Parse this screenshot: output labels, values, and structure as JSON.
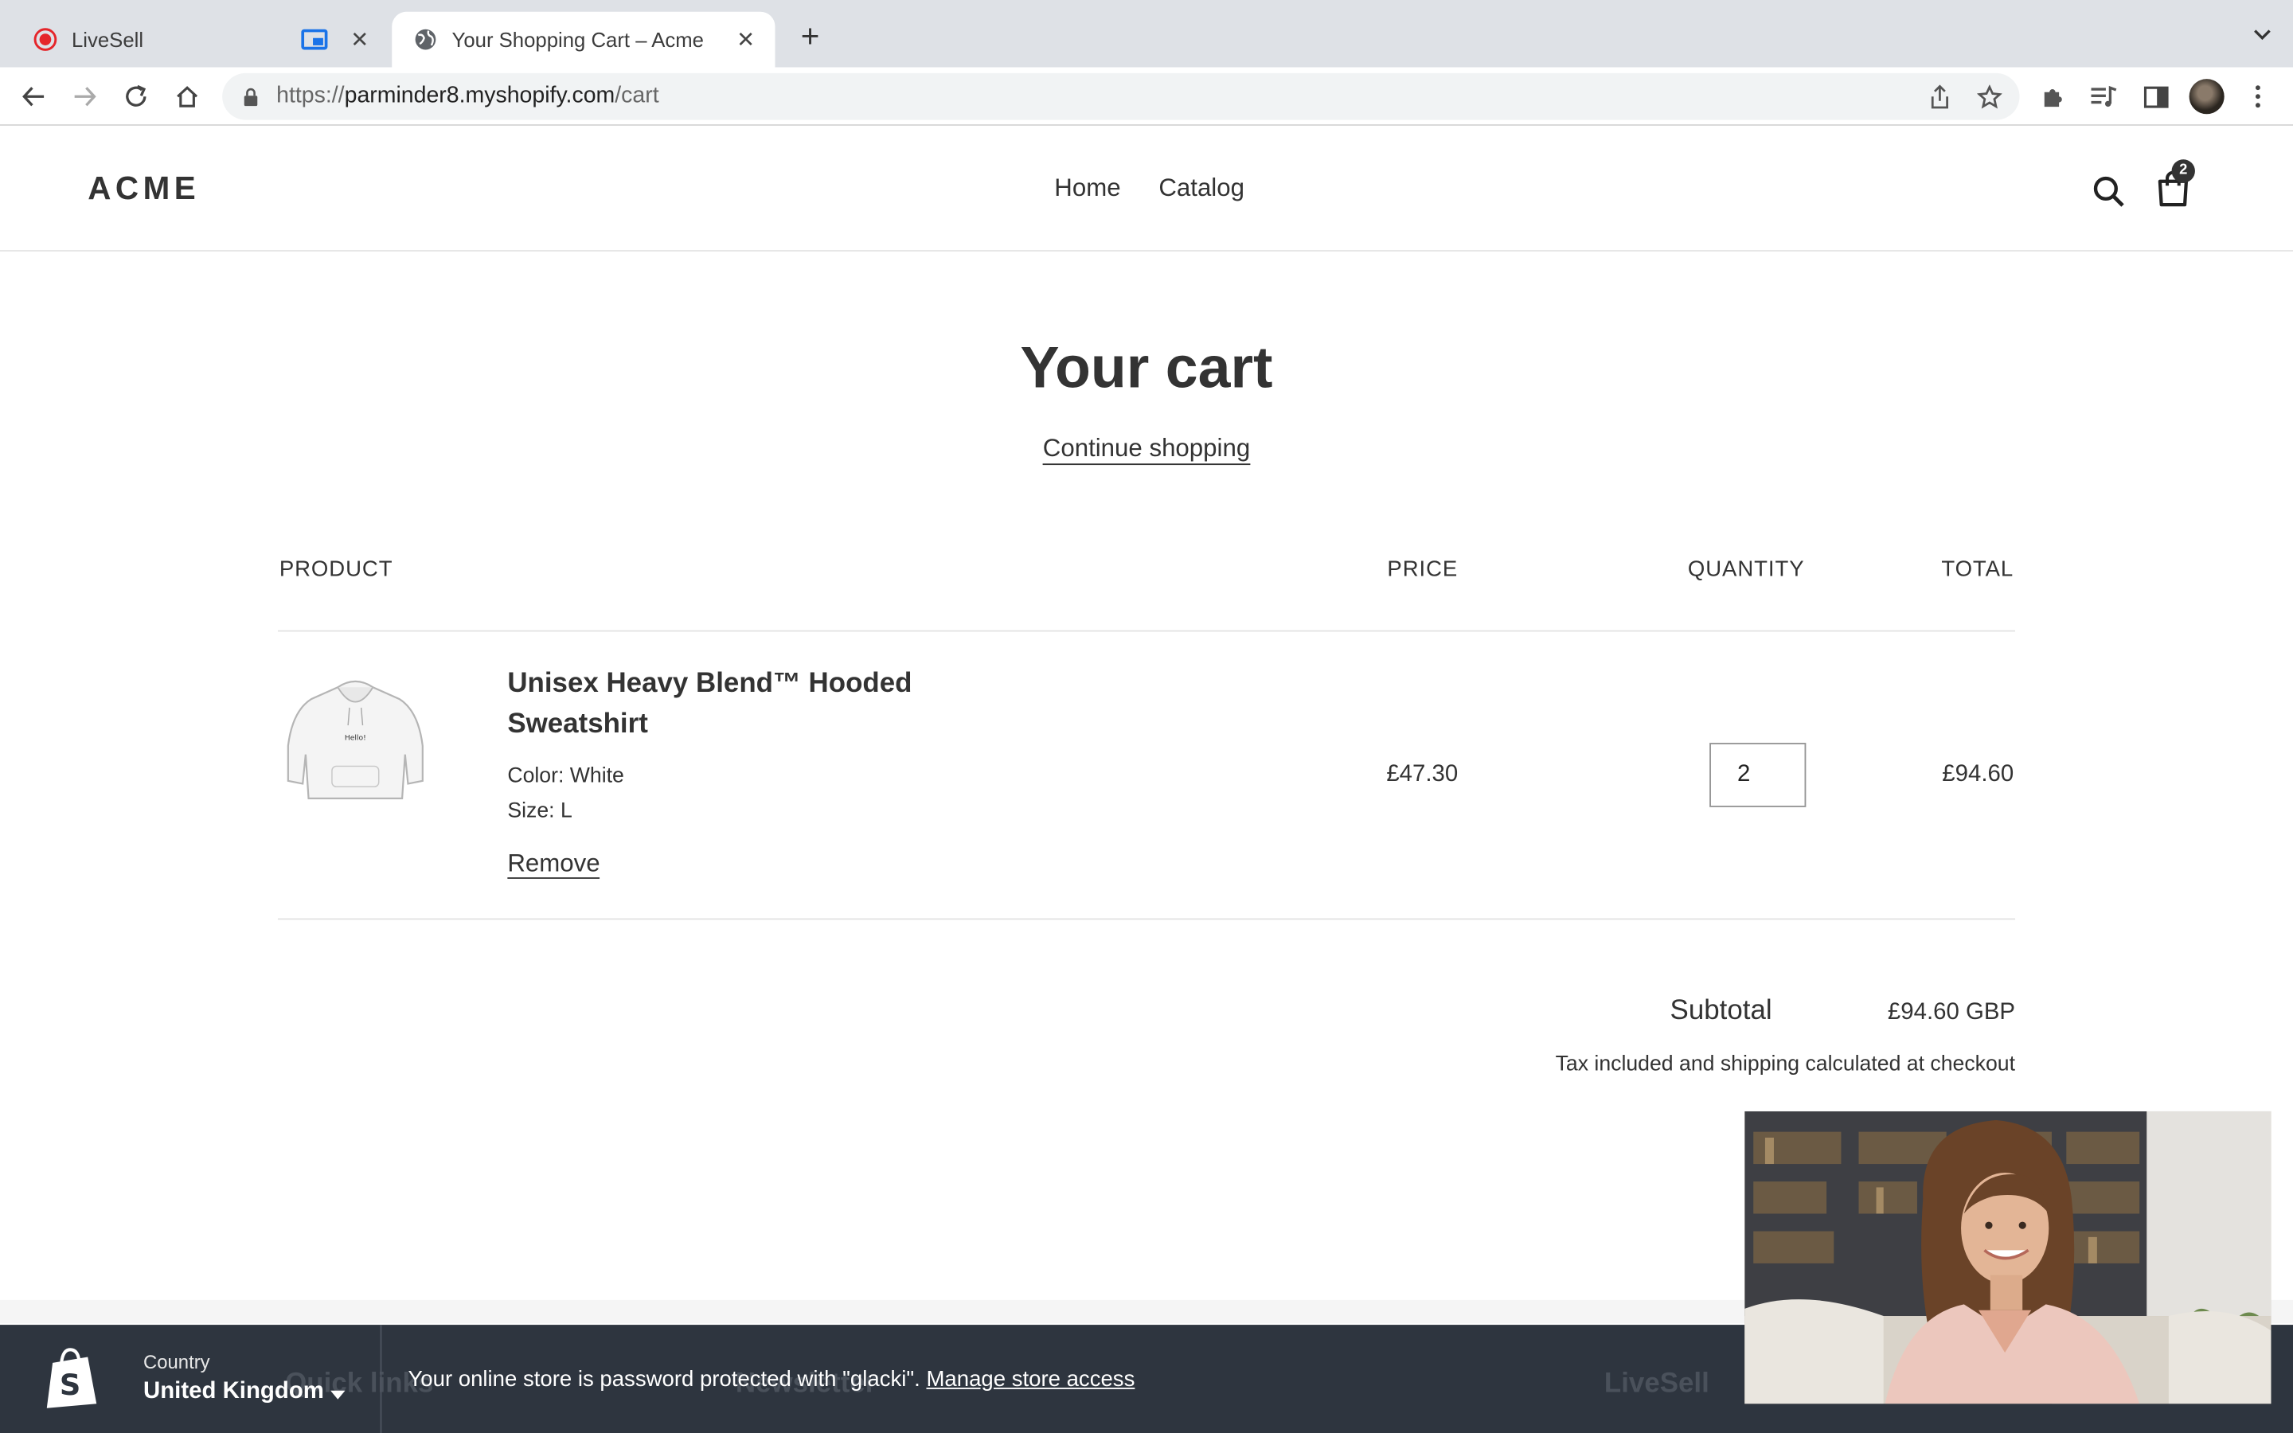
{
  "browser": {
    "tabs": [
      {
        "title": "LiveSell",
        "active": false
      },
      {
        "title": "Your Shopping Cart – Acme",
        "active": true
      }
    ],
    "url": {
      "scheme": "https://",
      "host": "parminder8.myshopify.com",
      "path": "/cart"
    }
  },
  "store": {
    "logo": "ACME",
    "nav": [
      "Home",
      "Catalog"
    ],
    "cart_count": "2"
  },
  "cart": {
    "title": "Your cart",
    "continue_label": "Continue shopping",
    "columns": {
      "product": "PRODUCT",
      "price": "PRICE",
      "quantity": "QUANTITY",
      "total": "TOTAL"
    },
    "items": [
      {
        "name": "Unisex Heavy Blend™ Hooded Sweatshirt",
        "color": "Color: White",
        "size": "Size: L",
        "remove_label": "Remove",
        "price": "£47.30",
        "quantity": "2",
        "total": "£94.60",
        "print_text": "Hello!"
      }
    ],
    "subtotal_label": "Subtotal",
    "subtotal_value": "£94.60 GBP",
    "tax_note": "Tax included and shipping calculated at checkout"
  },
  "password_bar": {
    "country_label": "Country",
    "country_value": "United Kingdom",
    "message": "Your online store is password protected with \"glacki\".",
    "link": "Manage store access"
  },
  "footer_partial": {
    "quick_links": "Quick links",
    "newsletter": "Newsletter",
    "livesell": "LiveSell"
  },
  "colors": {
    "tabbar": "#dee1e6",
    "pw_bar": "#2e353f",
    "text": "#333333",
    "livesell_red": "#e5252a",
    "pip_blue": "#1a73e8"
  },
  "icons": [
    "record-icon",
    "picture-in-picture-icon",
    "globe-icon",
    "close-icon",
    "plus-icon",
    "chevron-down-icon",
    "back-icon",
    "forward-icon",
    "reload-icon",
    "home-icon",
    "lock-icon",
    "share-icon",
    "star-icon",
    "extensions-icon",
    "media-queue-icon",
    "side-panel-icon",
    "kebab-menu-icon",
    "search-icon",
    "shopping-bag-icon",
    "shopify-icon"
  ]
}
